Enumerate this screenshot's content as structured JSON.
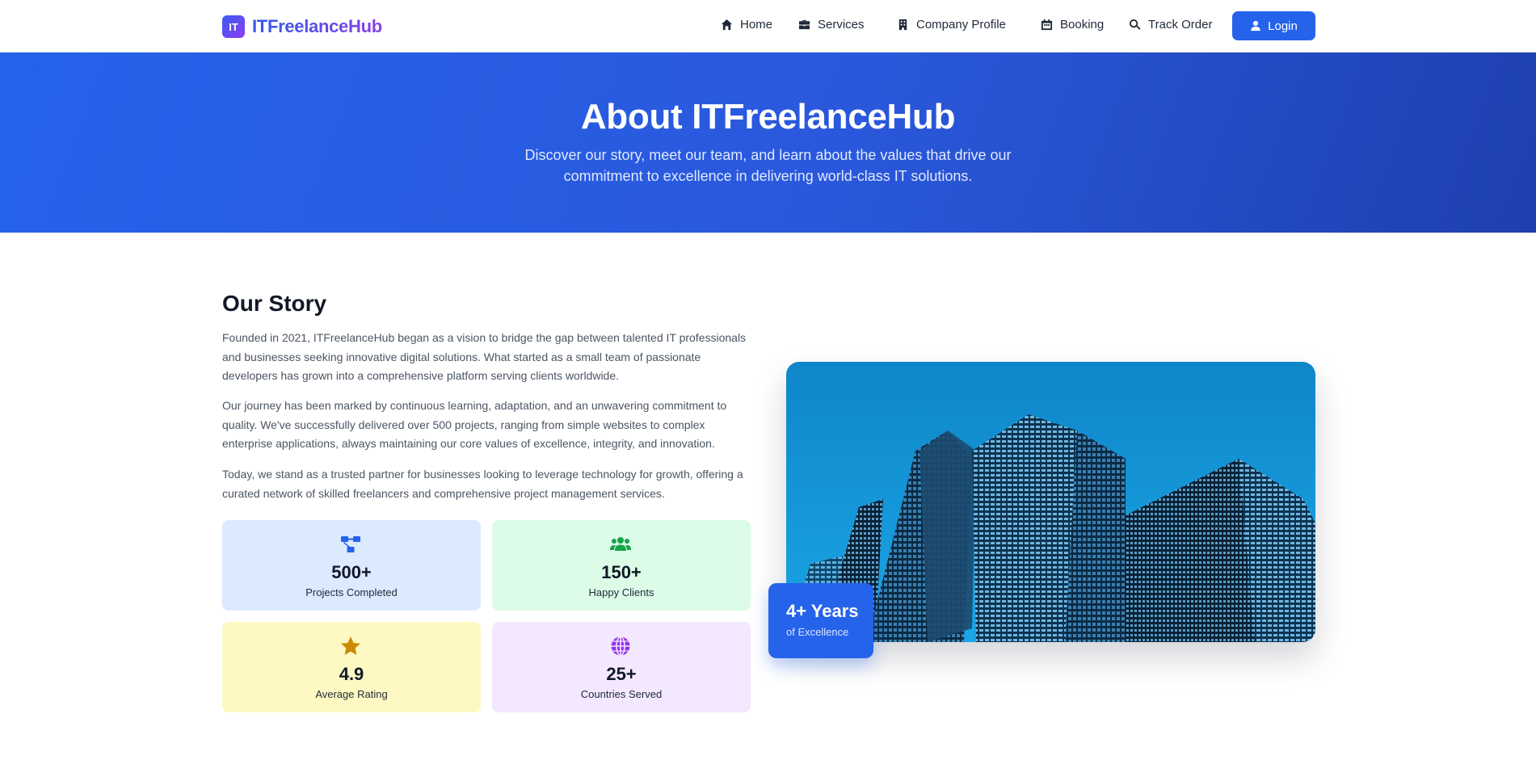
{
  "brand": {
    "mark": "IT",
    "name": "ITFreelanceHub"
  },
  "nav": {
    "items": [
      {
        "label": "Home",
        "icon": "home-icon"
      },
      {
        "label": "Services",
        "icon": "briefcase-icon"
      },
      {
        "label": "Company Profile",
        "icon": "building-icon"
      },
      {
        "label": "Booking",
        "icon": "calendar-icon"
      },
      {
        "label": "Track Order",
        "icon": "search-icon"
      }
    ],
    "login_label": "Login"
  },
  "hero": {
    "title": "About ITFreelanceHub",
    "subtitle": "Discover our story, meet our team, and learn about the values that drive our commitment to excellence in delivering world-class IT solutions."
  },
  "story": {
    "title": "Our Story",
    "paragraphs": [
      "Founded in 2021, ITFreelanceHub began as a vision to bridge the gap between talented IT professionals and businesses seeking innovative digital solutions. What started as a small team of passionate developers has grown into a comprehensive platform serving clients worldwide.",
      "Our journey has been marked by continuous learning, adaptation, and an unwavering commitment to quality. We've successfully delivered over 500 projects, ranging from simple websites to complex enterprise applications, always maintaining our core values of excellence, integrity, and innovation.",
      "Today, we stand as a trusted partner for businesses looking to leverage technology for growth, offering a curated network of skilled freelancers and comprehensive project management services."
    ]
  },
  "stats": [
    {
      "value": "500+",
      "label": "Projects Completed",
      "icon": "project-diagram-icon",
      "bg": "#dbeafe",
      "color": "#2563eb"
    },
    {
      "value": "150+",
      "label": "Happy Clients",
      "icon": "users-icon",
      "bg": "#dcfce7",
      "color": "#16a34a"
    },
    {
      "value": "4.9",
      "label": "Average Rating",
      "icon": "star-icon",
      "bg": "#fef9c3",
      "color": "#ca8a04"
    },
    {
      "value": "25+",
      "label": "Countries Served",
      "icon": "globe-icon",
      "bg": "#f3e8ff",
      "color": "#9333ea"
    }
  ],
  "badge": {
    "value": "4+ Years",
    "label": "of Excellence"
  },
  "colors": {
    "primary": "#2563eb",
    "hero_end": "#1e3fae",
    "text": "#111827",
    "muted": "#4b5563"
  }
}
